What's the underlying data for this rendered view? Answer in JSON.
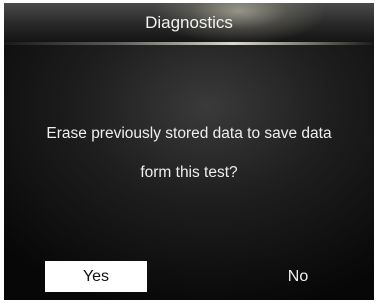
{
  "header": {
    "title": "Diagnostics"
  },
  "dialog": {
    "message_line_1": "Erase previously stored data to save data",
    "message_line_2": "form this test?"
  },
  "buttons": {
    "yes_label": "Yes",
    "no_label": "No",
    "selected": "Yes"
  },
  "colors": {
    "background": "#111111",
    "text": "#eeeeee",
    "selected_button_bg": "#ffffff",
    "selected_button_text": "#111111"
  }
}
